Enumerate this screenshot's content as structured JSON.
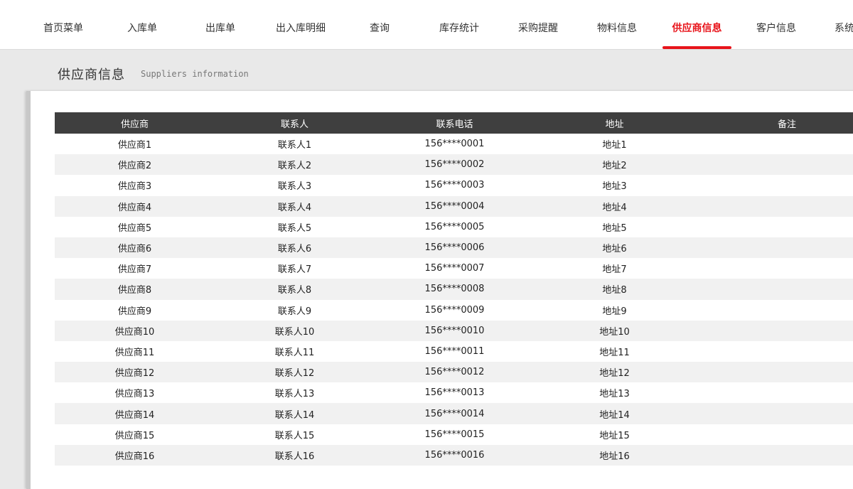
{
  "nav": {
    "items": [
      {
        "label": "首页菜单"
      },
      {
        "label": "入库单"
      },
      {
        "label": "出库单"
      },
      {
        "label": "出入库明细"
      },
      {
        "label": "查询"
      },
      {
        "label": "库存统计"
      },
      {
        "label": "采购提醒"
      },
      {
        "label": "物料信息"
      },
      {
        "label": "供应商信息",
        "active": true
      },
      {
        "label": "客户信息"
      },
      {
        "label": "系统"
      }
    ],
    "accent_color": "#e8141b"
  },
  "header": {
    "title": "供应商信息",
    "subtitle": "Suppliers information"
  },
  "table": {
    "columns": [
      "供应商",
      "联系人",
      "联系电话",
      "地址",
      "备注"
    ],
    "rows": [
      [
        "供应商1",
        "联系人1",
        "156****0001",
        "地址1",
        ""
      ],
      [
        "供应商2",
        "联系人2",
        "156****0002",
        "地址2",
        ""
      ],
      [
        "供应商3",
        "联系人3",
        "156****0003",
        "地址3",
        ""
      ],
      [
        "供应商4",
        "联系人4",
        "156****0004",
        "地址4",
        ""
      ],
      [
        "供应商5",
        "联系人5",
        "156****0005",
        "地址5",
        ""
      ],
      [
        "供应商6",
        "联系人6",
        "156****0006",
        "地址6",
        ""
      ],
      [
        "供应商7",
        "联系人7",
        "156****0007",
        "地址7",
        ""
      ],
      [
        "供应商8",
        "联系人8",
        "156****0008",
        "地址8",
        ""
      ],
      [
        "供应商9",
        "联系人9",
        "156****0009",
        "地址9",
        ""
      ],
      [
        "供应商10",
        "联系人10",
        "156****0010",
        "地址10",
        ""
      ],
      [
        "供应商11",
        "联系人11",
        "156****0011",
        "地址11",
        ""
      ],
      [
        "供应商12",
        "联系人12",
        "156****0012",
        "地址12",
        ""
      ],
      [
        "供应商13",
        "联系人13",
        "156****0013",
        "地址13",
        ""
      ],
      [
        "供应商14",
        "联系人14",
        "156****0014",
        "地址14",
        ""
      ],
      [
        "供应商15",
        "联系人15",
        "156****0015",
        "地址15",
        ""
      ],
      [
        "供应商16",
        "联系人16",
        "156****0016",
        "地址16",
        ""
      ]
    ]
  }
}
